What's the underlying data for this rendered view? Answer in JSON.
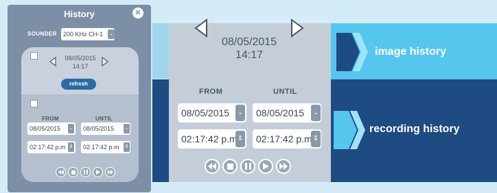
{
  "dialog": {
    "title": "History",
    "sounder_label": "SOUNDER",
    "sounder_value": "200 KHz CH-1",
    "image_history": {
      "date": "08/05/2015",
      "time": "14:17",
      "refresh_label": "refresh"
    },
    "recording": {
      "from_label": "FROM",
      "until_label": "UNTIL",
      "from_date": "08/05/2015",
      "until_date": "08/05/2015",
      "from_time": "02:17:42 p.m",
      "until_time": "02:17:42 p.m"
    }
  },
  "zoom": {
    "image_history": {
      "date": "08/05/2015",
      "time": "14:17"
    },
    "recording": {
      "from_label": "FROM",
      "until_label": "UNTIL",
      "from_date": "08/05/2015",
      "until_date": "08/05/2015",
      "from_time": "02:17:42 p.m",
      "until_time": "02:17:42 p.m"
    }
  },
  "callouts": {
    "image_history": "image history",
    "recording_history": "recording history"
  },
  "colors": {
    "dialog_bg": "#7d8fa7",
    "light_blue": "#55c6ee",
    "dark_blue": "#1d4b82",
    "refresh_button": "#2a6aa6"
  },
  "icons": [
    "close-icon",
    "chevron-left-icon",
    "chevron-right-icon",
    "rewind-icon",
    "stop-icon",
    "pause-icon",
    "play-icon",
    "fast-forward-icon",
    "chevron-down-icon",
    "stepper-icon"
  ]
}
